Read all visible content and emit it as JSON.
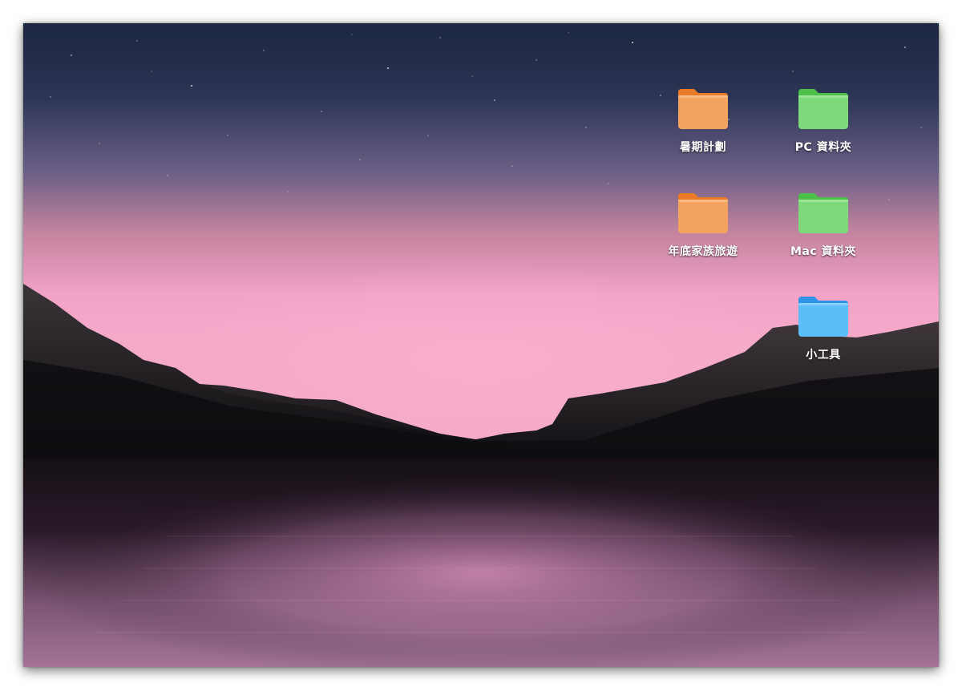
{
  "desktop": {
    "folders": [
      {
        "label": "暑期計劃",
        "color": "orange"
      },
      {
        "label": "PC 資料夾",
        "color": "green"
      },
      {
        "label": "年底家族旅遊",
        "color": "orange"
      },
      {
        "label": "Mac 資料夾",
        "color": "green"
      },
      {
        "label": "小工具",
        "color": "blue"
      }
    ]
  },
  "colors": {
    "orange_front": "#F4A35F",
    "orange_back": "#E97A28",
    "green_front": "#7DD97A",
    "green_back": "#4DBF4B",
    "blue_front": "#5CBEF9",
    "blue_back": "#2E94E8",
    "sky_top": "#1E2944",
    "sky_horizon": "#F2A2C6"
  },
  "icons": {
    "folder": "folder-icon"
  }
}
